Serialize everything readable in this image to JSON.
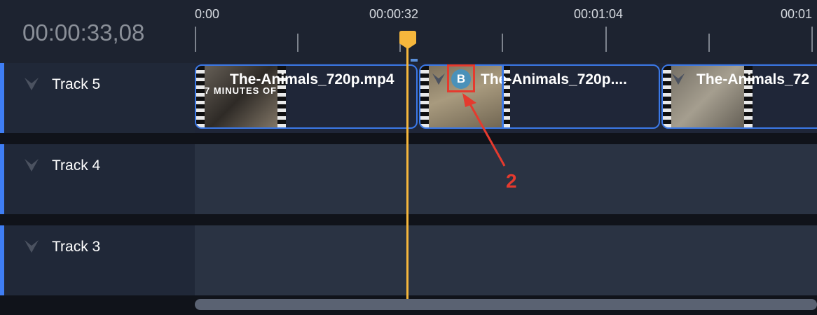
{
  "timecode": "00:00:33,08",
  "ruler": {
    "labels": [
      "0:00",
      "00:00:32",
      "00:01:04",
      "00:01"
    ]
  },
  "tracks": [
    {
      "label": "Track 5"
    },
    {
      "label": "Track 4"
    },
    {
      "label": "Track 3"
    }
  ],
  "clips": [
    {
      "title": "The-Animals_720p.mp4",
      "thumb_text": "7 MINUTES OF"
    },
    {
      "title": "The-Animals_720p...."
    },
    {
      "title": "The-Animals_72"
    }
  ],
  "badge": {
    "letter": "B"
  },
  "annotation": {
    "number": "2",
    "color": "#e53a2e"
  },
  "colors": {
    "accent": "#3f7ef4",
    "playhead": "#f6b73c",
    "clip_border": "#3b79e8"
  }
}
